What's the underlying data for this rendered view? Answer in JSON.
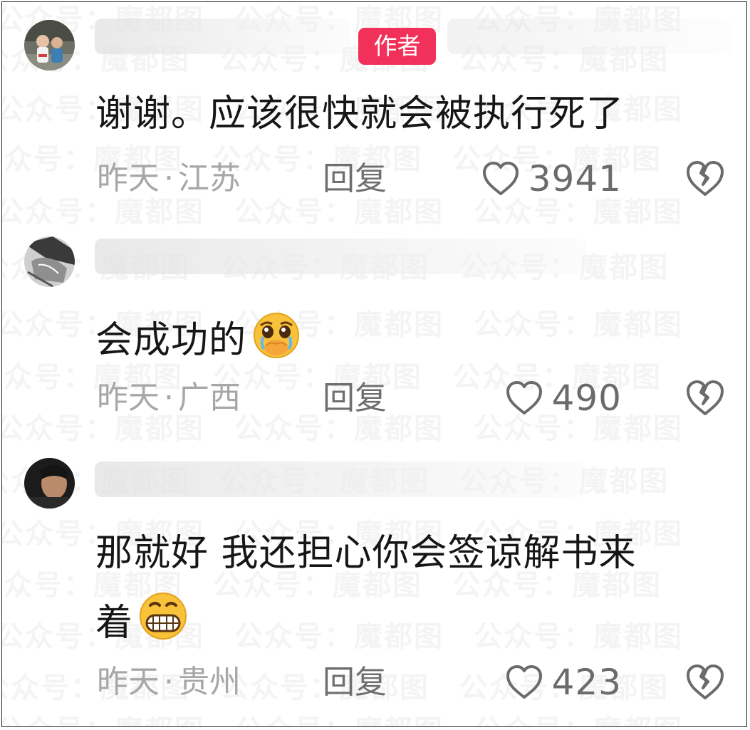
{
  "watermark": {
    "text": "公众号：魔都图"
  },
  "comments": [
    {
      "author_badge": "作者",
      "text": "谢谢。应该很快就会被执行死了",
      "time": "昨天",
      "location": "江苏",
      "separator": "·",
      "reply_label": "回复",
      "likes": "3941",
      "emoji": ""
    },
    {
      "text": "会成功的",
      "time": "昨天",
      "location": "广西",
      "separator": "·",
      "reply_label": "回复",
      "likes": "490",
      "emoji": "pleading-face-emoji"
    },
    {
      "text_line1": "那就好 我还担心你会签谅解书来",
      "text_line2": "着",
      "time": "昨天",
      "location": "贵州",
      "separator": "·",
      "reply_label": "回复",
      "likes": "423",
      "emoji": "grimacing-face-emoji"
    }
  ],
  "icons": {
    "like": "heart-outline-icon",
    "dislike": "broken-heart-icon"
  },
  "colors": {
    "author_badge": "#f2315a",
    "meta_text": "#a7a7a7",
    "reply_text": "#6f6f6f",
    "body_text": "#161616"
  }
}
